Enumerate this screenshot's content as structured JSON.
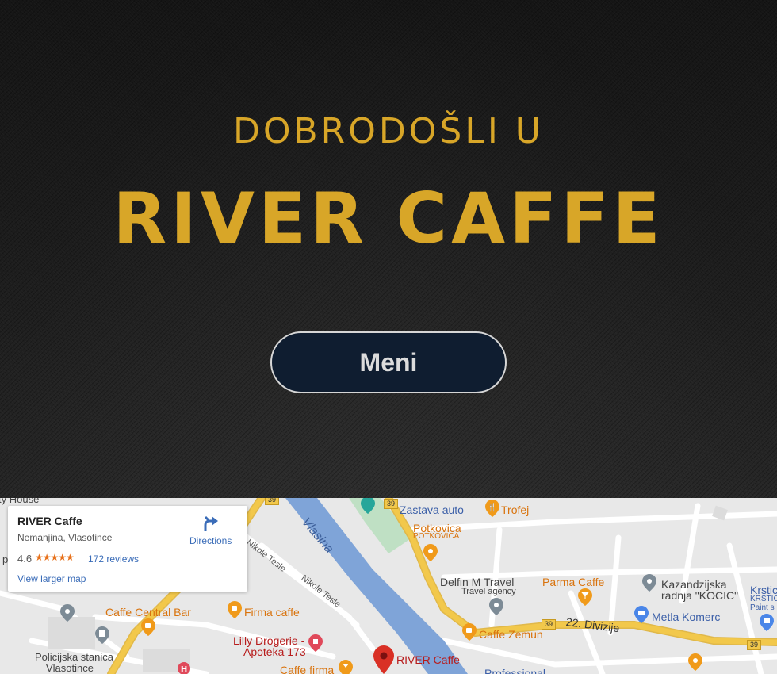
{
  "hero": {
    "welcome": "DOBRODOŠLI U",
    "brand": "RIVER CAFFE",
    "menu_button": "Meni"
  },
  "colors": {
    "gold": "#d8a628",
    "button_bg": "#0f1d30",
    "map_bg": "#e8e8e8",
    "river": "#7fa4d8",
    "highway": "#f2c84b"
  },
  "map": {
    "card": {
      "title": "RIVER Caffe",
      "address": "Nemanjina, Vlasotince",
      "rating": "4.6",
      "stars": "★★★★★",
      "reviews": "172 reviews",
      "larger_map": "View larger map",
      "directions": "Directions"
    },
    "places": {
      "zastava": "Zastava auto",
      "trofej": "Trofej",
      "potkovica": "Potkovica",
      "potkovica_sub": "POTKOVICA",
      "delfin": "Delfin M Travel",
      "delfin_sub": "Travel agency",
      "parma": "Parma Caffe",
      "kazandzijska1": "Kazandzijska",
      "kazandzijska2": "radnja \"KOCIC\"",
      "krstic1": "Krstic",
      "krstic2": "KRSTIC",
      "krstic3": "Paint s",
      "metla": "Metla Komerc",
      "central": "Caffe Central Bar",
      "firma": "Firma caffe",
      "zemun": "Caffe Zemun",
      "lilly1": "Lilly Drogerie -",
      "lilly2": "Apoteka 173",
      "policija1": "Policijska stanica",
      "policija2": "Vlasotince",
      "river_caffe": "RIVER Caffe",
      "caffe_firma": "Caffe firma",
      "professional": "Professional",
      "house": "ty House",
      "p_letter": "p"
    },
    "roads": {
      "nikole1": "Nikole Tesle",
      "nikole2": "Nikole Tesle",
      "vlasina": "Vlasina",
      "divizije": "22. Divizije",
      "route": "39"
    },
    "icons": [
      "coffee-pin-icon",
      "restaurant-pin-icon",
      "bar-pin-icon",
      "shop-pin-icon",
      "location-pin-icon",
      "directions-icon"
    ]
  }
}
